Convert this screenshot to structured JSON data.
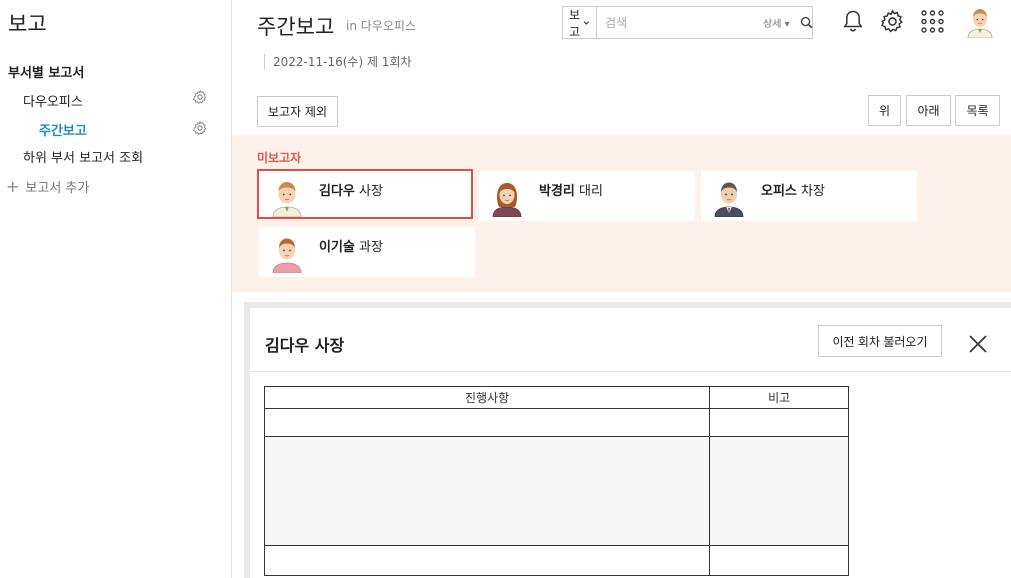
{
  "sidebar": {
    "title": "보고",
    "section": "부서별 보고서",
    "items": [
      {
        "label": "다우오피스"
      },
      {
        "label": "주간보고"
      },
      {
        "label": "하위 부서 보고서 조회"
      }
    ],
    "add_label": "보고서 추가"
  },
  "header": {
    "title": "주간보고",
    "subtitle": "in 다우오피스",
    "date_line": "2022-11-16(수) 제 1회차"
  },
  "search": {
    "select_value": "보고",
    "placeholder": "검색",
    "detail_label": "상세 ▾"
  },
  "toolbar": {
    "exclude_label": "보고자 제외",
    "up_label": "위",
    "down_label": "아래",
    "list_label": "목록"
  },
  "reporters": {
    "label": "미보고자",
    "people": [
      {
        "name": "김다우",
        "rank": "사장"
      },
      {
        "name": "박경리",
        "rank": "대리"
      },
      {
        "name": "오피스",
        "rank": "차장"
      },
      {
        "name": "이기술",
        "rank": "과장"
      }
    ]
  },
  "panel": {
    "title": "김다우 사장",
    "prev_button": "이전 회차 불러오기",
    "columns": [
      "진행사항",
      "비고"
    ]
  },
  "colors": {
    "accent": "#1e8fb3",
    "alert": "#e05b4b",
    "reporter_bg": "#fdf1ec"
  }
}
